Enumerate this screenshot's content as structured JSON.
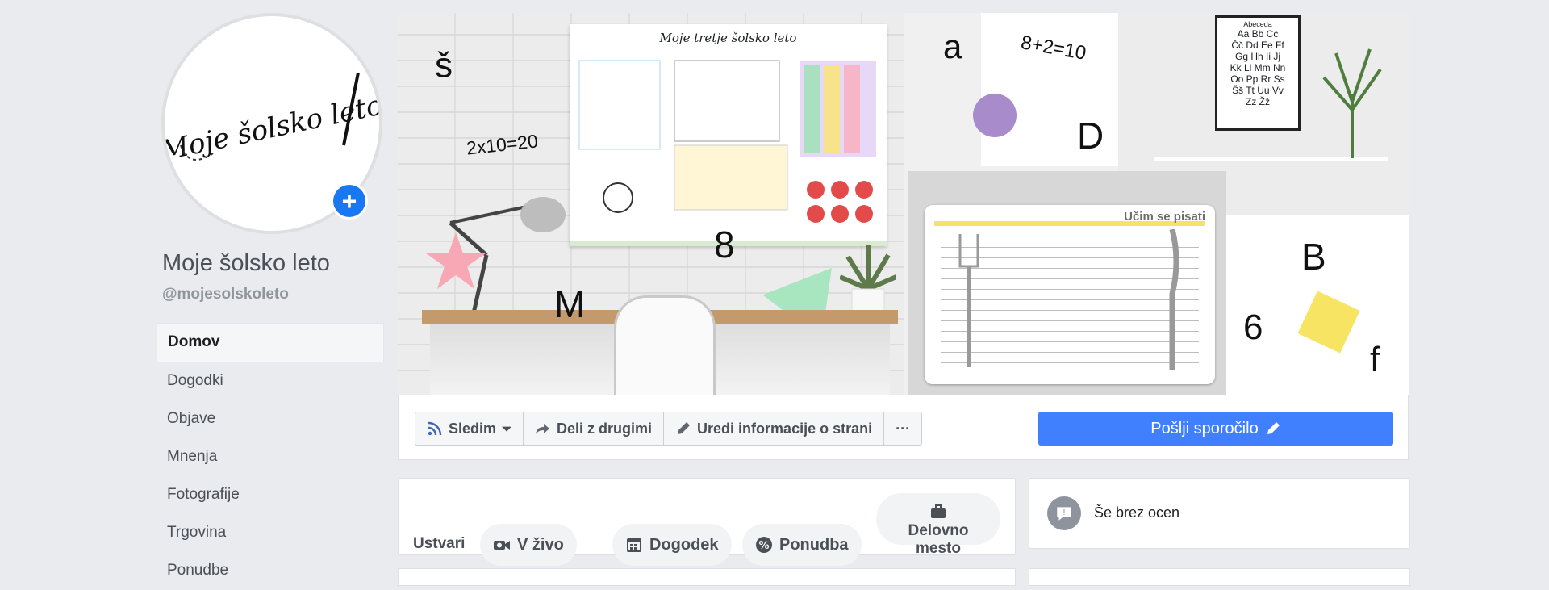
{
  "page": {
    "name": "Moje šolsko leto",
    "handle": "@mojesolskoleto",
    "avatar_script_text": "Moje šolsko leto",
    "avatar_add_symbol": "+"
  },
  "left_nav": {
    "items": [
      {
        "label": "Domov",
        "active": true
      },
      {
        "label": "Dogodki"
      },
      {
        "label": "Objave"
      },
      {
        "label": "Mnenja"
      },
      {
        "label": "Fotografije"
      },
      {
        "label": "Trgovina"
      },
      {
        "label": "Ponudbe"
      }
    ]
  },
  "cover": {
    "poster_title": "Moje tretje šolsko leto",
    "worksheet_title": "Učim se pisati",
    "frame_title": "Abeceda",
    "frame_letters": [
      "Aa Bb Cc",
      "Čč Dd Ee Ff",
      "Gg Hh Ii Jj",
      "Kk Ll Mm Nn",
      "Oo Pp Rr Ss",
      "Šš Tt Uu Vv",
      "Zz Žž"
    ],
    "decor_texts": {
      "s_caron": "š",
      "equation_1": "2x10=20",
      "digit_8": "8",
      "letter_M": "M",
      "letter_a": "a",
      "equation_2": "8+2=10",
      "letter_D": "D",
      "letter_B": "B",
      "digit_6": "6",
      "letter_f": "f"
    }
  },
  "actions": {
    "follow": "Sledim",
    "share": "Deli z drugimi",
    "edit": "Uredi informacije o strani",
    "more": "···",
    "send_message": "Pošlji sporočilo"
  },
  "create": {
    "label": "Ustvari",
    "live": "V živo",
    "event": "Dogodek",
    "offer": "Ponudba",
    "job_line1": "Delovno",
    "job_line2": "mesto"
  },
  "rating": {
    "text": "Še brez ocen"
  },
  "colors": {
    "accent": "#4080ff",
    "fb_blue": "#1877f2",
    "background": "#e9ebee"
  }
}
